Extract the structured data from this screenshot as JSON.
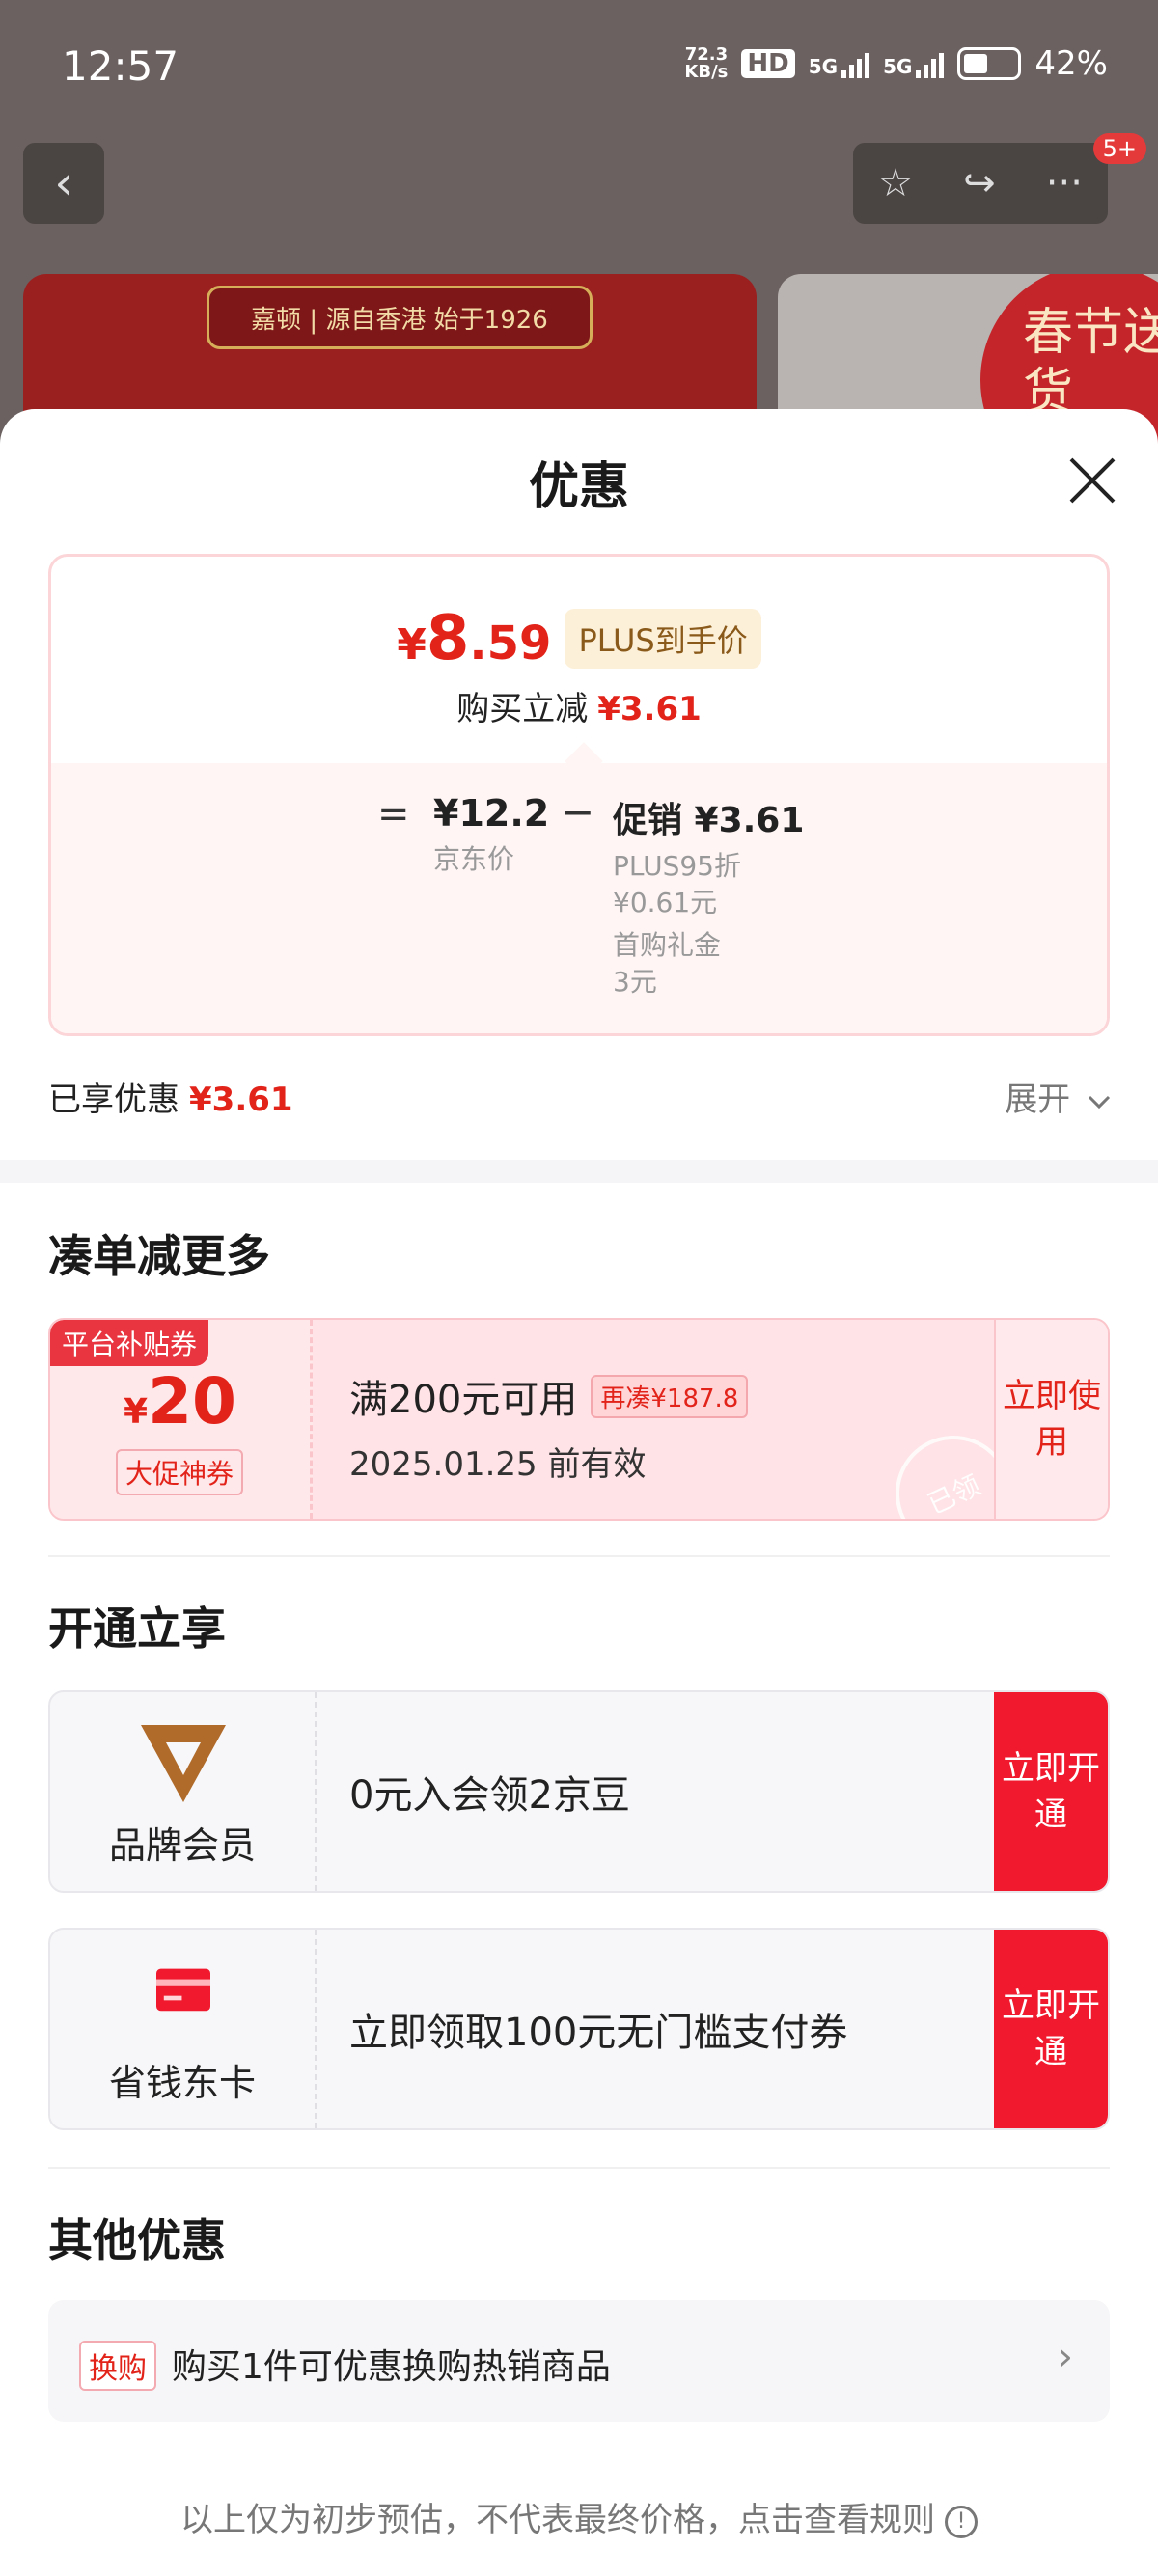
{
  "status_bar": {
    "time": "12:57",
    "speed_value": "72.3",
    "speed_unit": "KB/s",
    "hd": "HD",
    "net1": "5G",
    "net2": "5G",
    "battery": "42%"
  },
  "nav": {
    "back": "‹",
    "favorite": "☆",
    "share": "↪",
    "more": "···",
    "badge": "5+"
  },
  "banner": {
    "brand_text": "嘉顿 | 源自香港 始于1926",
    "promo_text": "春节送货"
  },
  "sheet": {
    "title": "优惠"
  },
  "price_card": {
    "currency": "¥",
    "price_int": "8",
    "price_dec": ".59",
    "tag": "PLUS到手价",
    "reduce_label": "购买立减",
    "reduce_value": "¥3.61",
    "equals": "=",
    "jd_price": "¥12.2",
    "jd_price_label": "京东价",
    "minus": "−",
    "promo_label": "促销 ¥3.61",
    "promo_details": [
      "PLUS95折",
      "¥0.61元",
      "首购礼金",
      "3元"
    ]
  },
  "enjoyed": {
    "label": "已享优惠",
    "value": "¥3.61",
    "expand": "展开"
  },
  "section_more": {
    "title": "凑单减更多",
    "coupon": {
      "tag": "平台补贴券",
      "currency": "¥",
      "amount": "20",
      "kind": "大促神券",
      "condition": "满200元可用",
      "more": "再凑¥187.8",
      "date": "2025.01.25 前有效",
      "button": "立即使用",
      "stamp": "已领"
    }
  },
  "section_open": {
    "title": "开通立享",
    "cards": [
      {
        "name": "品牌会员",
        "text": "0元入会领2京豆",
        "button": "立即开通",
        "icon": "brand-v-icon",
        "color": "#b06a2a"
      },
      {
        "name": "省钱东卡",
        "text": "立即领取100元无门槛支付券",
        "button": "立即开通",
        "icon": "card-icon",
        "color": "#f0192d"
      }
    ]
  },
  "section_other": {
    "title": "其他优惠",
    "tag": "换购",
    "text": "购买1件可优惠换购热销商品",
    "chevron": "›"
  },
  "footer": {
    "note": "以上仅为初步预估，不代表最终价格，点击查看规则",
    "info": "!"
  }
}
